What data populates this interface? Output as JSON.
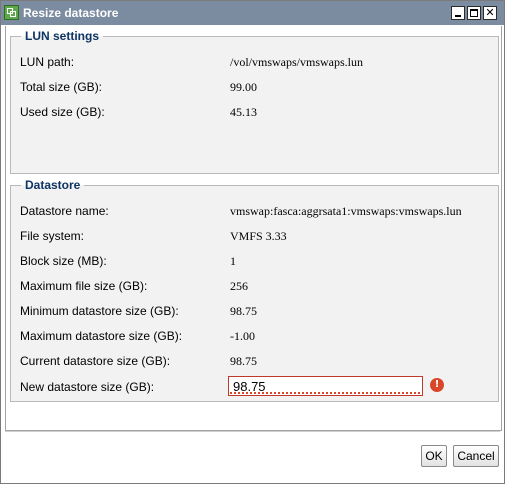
{
  "window": {
    "title": "Resize datastore",
    "icon": "vmware-app-icon",
    "controls": [
      "minimize",
      "maximize",
      "close"
    ]
  },
  "lun_settings": {
    "legend": "LUN settings",
    "rows": [
      {
        "label": "LUN path:",
        "value": "/vol/vmswaps/vmswaps.lun"
      },
      {
        "label": "Total size (GB):",
        "value": "99.00"
      },
      {
        "label": "Used size (GB):",
        "value": "45.13"
      }
    ]
  },
  "datastore": {
    "legend": "Datastore",
    "rows": [
      {
        "label": "Datastore name:",
        "value": "vmswap:fasca:aggrsata1:vmswaps:vmswaps.lun"
      },
      {
        "label": "File system:",
        "value": "VMFS 3.33"
      },
      {
        "label": "Block size (MB):",
        "value": "1"
      },
      {
        "label": "Maximum file size (GB):",
        "value": "256"
      },
      {
        "label": "Minimum datastore size (GB):",
        "value": "98.75"
      },
      {
        "label": "Maximum datastore size (GB):",
        "value": "-1.00"
      },
      {
        "label": "Current datastore size (GB):",
        "value": "98.75"
      }
    ],
    "new_size": {
      "label": "New datastore size (GB):",
      "value": "98.75",
      "error_icon": "error-icon"
    }
  },
  "buttons": {
    "ok": "OK",
    "cancel": "Cancel"
  },
  "colors": {
    "titlebar": "#7b8ca0",
    "legend_text": "#0e3463",
    "group_background": "#f2f2f2",
    "error": "#d9472b"
  }
}
